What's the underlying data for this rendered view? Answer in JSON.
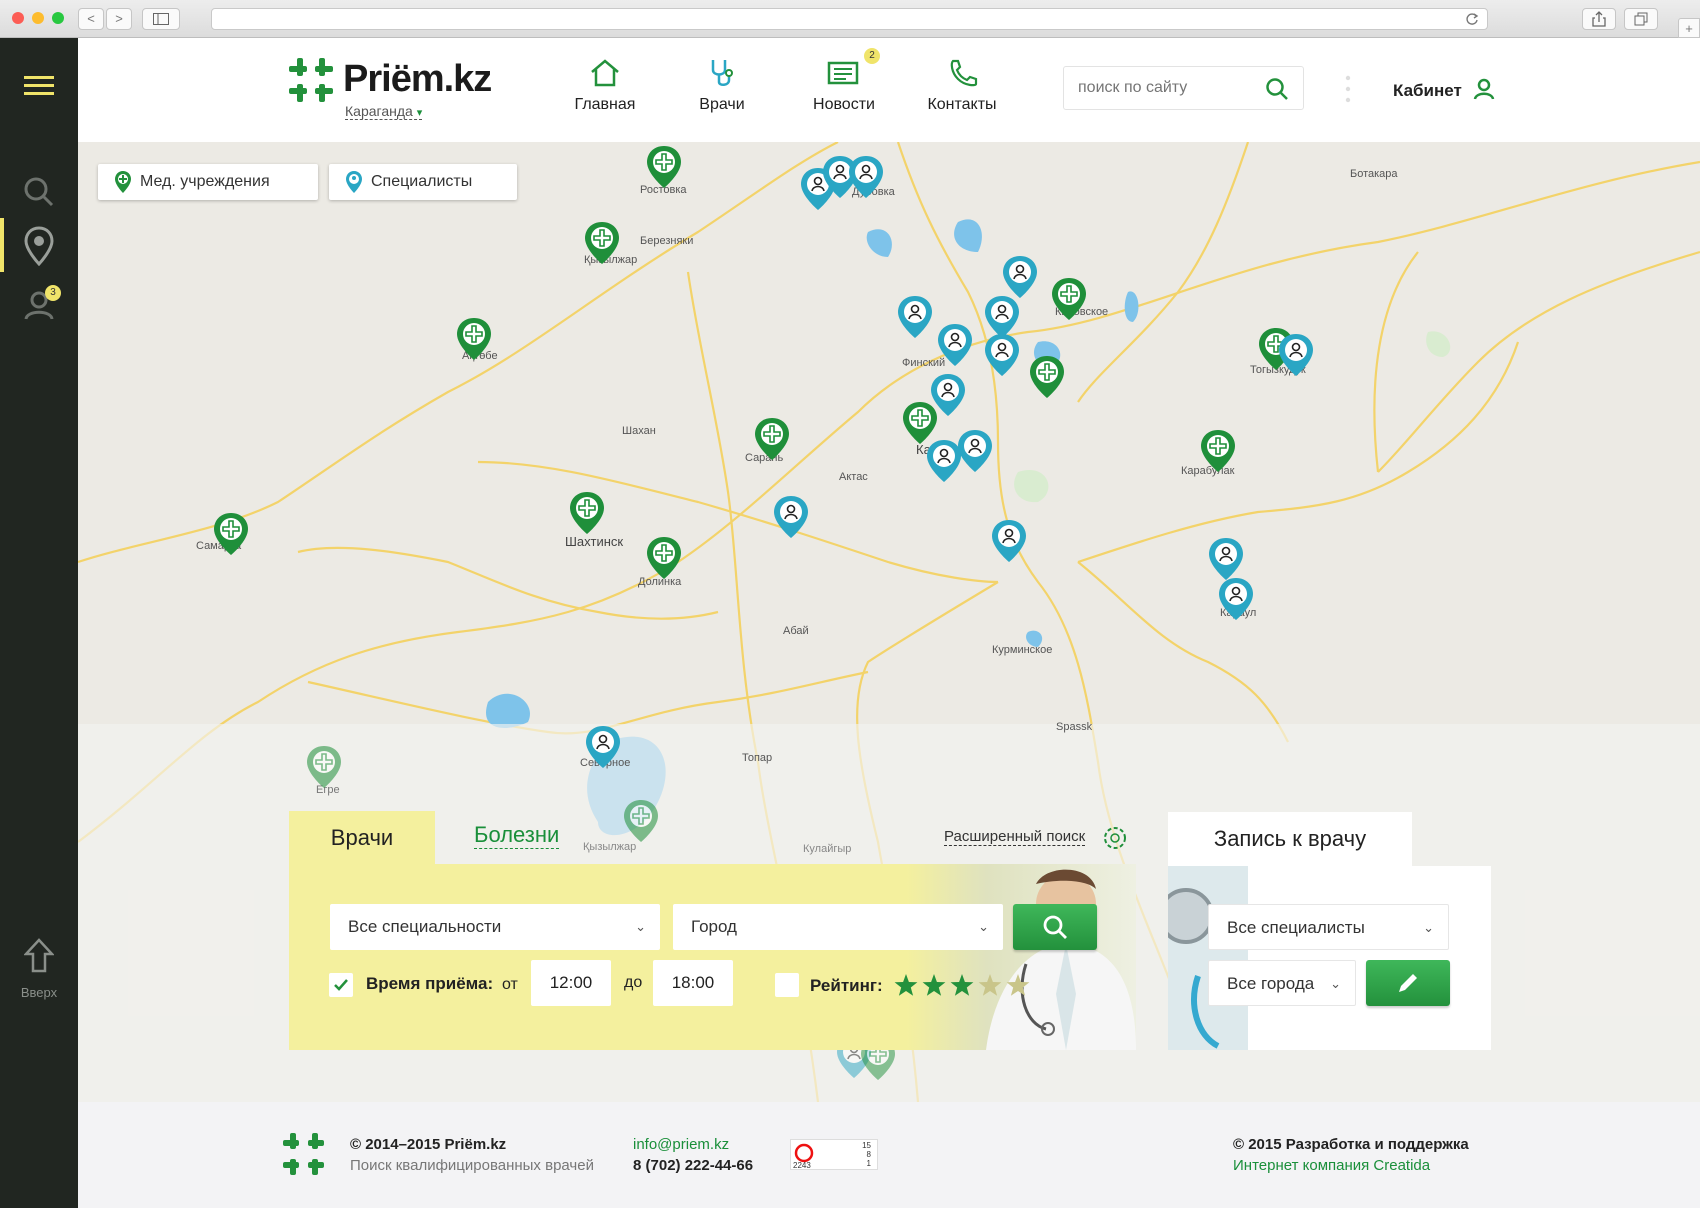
{
  "browser": {
    "back": "<",
    "forward": ">"
  },
  "sidebar": {
    "badge": "3",
    "up_label": "Вверх"
  },
  "header": {
    "logo": "Priëm.kz",
    "city": "Караганда",
    "nav": [
      {
        "label": "Главная",
        "icon": "home-icon"
      },
      {
        "label": "Врачи",
        "icon": "stethoscope-icon"
      },
      {
        "label": "Новости",
        "icon": "newspaper-icon",
        "badge": "2"
      },
      {
        "label": "Контакты",
        "icon": "phone-icon"
      }
    ],
    "search_placeholder": "поиск по сайту",
    "cabinet": "Кабинет"
  },
  "map": {
    "filters": [
      "Мед. учреждения",
      "Специалисты"
    ],
    "places": [
      "Ростовка",
      "Березняки",
      "Қызылжар",
      "Ақтөбе",
      "Шахан",
      "Сарань",
      "Актас",
      "Шахтинск",
      "Долинка",
      "Абай",
      "Финский",
      "Кировское",
      "Ботакара",
      "Тогызкудук",
      "Караганда",
      "Курминское",
      "Spassk",
      "Топар",
      "Северное",
      "Егре",
      "Қызылжар",
      "Кулайгыр",
      "Карабулак",
      "Самарка",
      "Караул",
      "Дубовка"
    ]
  },
  "search_panel": {
    "tab_doctors": "Врачи",
    "tab_diseases": "Болезни",
    "advanced": "Расширенный поиск",
    "specialty": "Все специальности",
    "city": "Город",
    "time_label": "Время приёма:",
    "from": "от",
    "to": "до",
    "time_from": "12:00",
    "time_to": "18:00",
    "rating_label": "Рейтинг:",
    "rating": 3,
    "rating_max": 5
  },
  "booking": {
    "title": "Запись к врачу",
    "specialists": "Все специалисты",
    "cities": "Все города"
  },
  "footer": {
    "copyright": "© 2014–2015 Priëm.kz",
    "tagline": "Поиск квалифицированных врачей",
    "email": "info@priem.kz",
    "phone": "8 (702) 222-44-66",
    "counter": [
      "15",
      "8",
      "1",
      "2243"
    ],
    "dev": "© 2015 Разработка и поддержка",
    "company": "Интернет компания Creatida"
  },
  "colors": {
    "green": "#1f8f3a",
    "teal": "#2aa6c4",
    "yellow": "#f4f09e",
    "sidebar": "#212621"
  }
}
